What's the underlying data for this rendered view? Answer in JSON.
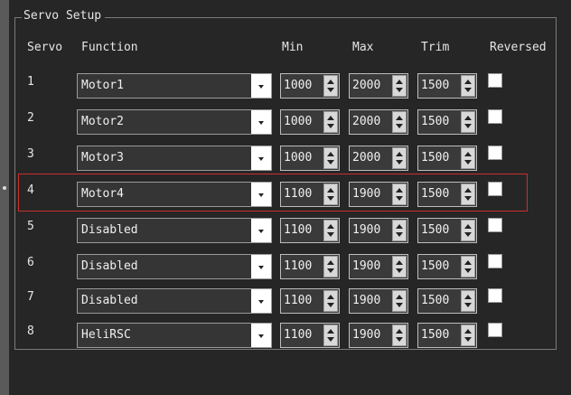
{
  "window": {
    "group_title": "Servo Setup"
  },
  "headers": {
    "servo": "Servo",
    "function": "Function",
    "min": "Min",
    "max": "Max",
    "trim": "Trim",
    "reversed": "Reversed"
  },
  "rows": [
    {
      "servo": "1",
      "function": "Motor1",
      "min": "1000",
      "max": "2000",
      "trim": "1500",
      "reversed": false
    },
    {
      "servo": "2",
      "function": "Motor2",
      "min": "1000",
      "max": "2000",
      "trim": "1500",
      "reversed": false
    },
    {
      "servo": "3",
      "function": "Motor3",
      "min": "1000",
      "max": "2000",
      "trim": "1500",
      "reversed": false
    },
    {
      "servo": "4",
      "function": "Motor4",
      "min": "1100",
      "max": "1900",
      "trim": "1500",
      "reversed": false
    },
    {
      "servo": "5",
      "function": "Disabled",
      "min": "1100",
      "max": "1900",
      "trim": "1500",
      "reversed": false
    },
    {
      "servo": "6",
      "function": "Disabled",
      "min": "1100",
      "max": "1900",
      "trim": "1500",
      "reversed": false
    },
    {
      "servo": "7",
      "function": "Disabled",
      "min": "1100",
      "max": "1900",
      "trim": "1500",
      "reversed": false
    },
    {
      "servo": "8",
      "function": "HeliRSC",
      "min": "1100",
      "max": "1900",
      "trim": "1500",
      "reversed": false
    }
  ],
  "highlight_color": "#c9302c"
}
